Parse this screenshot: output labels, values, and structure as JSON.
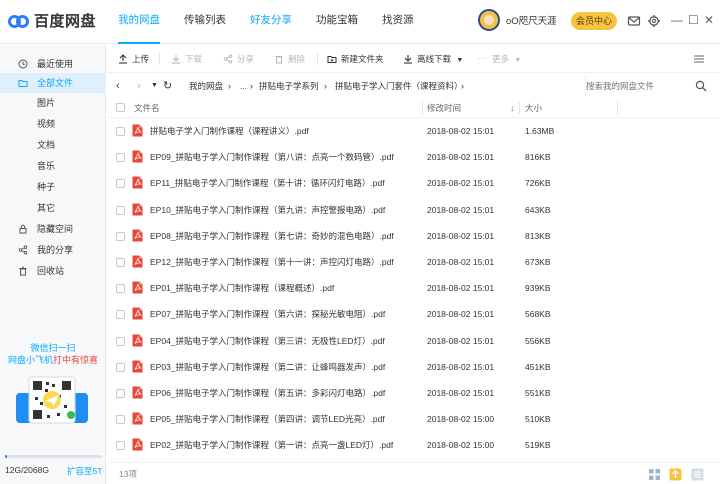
{
  "app": {
    "logo_text": "百度网盘"
  },
  "nav": {
    "tabs": [
      {
        "label": "我的网盘"
      },
      {
        "label": "传输列表"
      },
      {
        "label": "好友分享"
      },
      {
        "label": "功能宝箱"
      },
      {
        "label": "找资源"
      }
    ]
  },
  "user": {
    "name": "oO咫尺天涯",
    "vip_label": "会员中心"
  },
  "sidebar": {
    "items": [
      {
        "label": "最近使用",
        "icon": "clock-icon"
      },
      {
        "label": "全部文件",
        "icon": "folder-icon"
      },
      {
        "label": "图片"
      },
      {
        "label": "视频"
      },
      {
        "label": "文档"
      },
      {
        "label": "音乐"
      },
      {
        "label": "种子"
      },
      {
        "label": "其它"
      },
      {
        "label": "隐藏空间",
        "icon": "lock-icon"
      },
      {
        "label": "我的分享",
        "icon": "share-icon"
      },
      {
        "label": "回收站",
        "icon": "trash-icon"
      }
    ],
    "promo_line1": "微信扫一扫",
    "promo_line2a": "网盘小飞机",
    "promo_line2b": "打中有惊喜",
    "storage_text": "12G/2068G",
    "storage_fraction": 0.006,
    "expand_label": "扩容至5T"
  },
  "toolbar": {
    "upload": "上传",
    "download": "下载",
    "share": "分享",
    "delete": "删除",
    "new_folder": "新建文件夹",
    "offline_download": "离线下载",
    "more": "更多"
  },
  "breadcrumb": {
    "items": [
      "我的网盘",
      "...",
      "拼贴电子学系列",
      "拼贴电子学入门套件（课程资料）"
    ],
    "search_placeholder": "搜索我的网盘文件"
  },
  "list": {
    "headers": {
      "name": "文件名",
      "modified": "修改时间",
      "size": "大小"
    },
    "files": [
      {
        "name": "拼贴电子学入门制作课程（课程讲义）.pdf",
        "modified": "2018-08-02 15:01",
        "size": "1.63MB"
      },
      {
        "name": "EP09_拼贴电子学入门制作课程（第八讲：点亮一个数码管）.pdf",
        "modified": "2018-08-02 15:01",
        "size": "816KB"
      },
      {
        "name": "EP11_拼贴电子学入门制作课程（第十讲：循环闪灯电路）.pdf",
        "modified": "2018-08-02 15:01",
        "size": "726KB"
      },
      {
        "name": "EP10_拼贴电子学入门制作课程（第九讲：声控警报电路）.pdf",
        "modified": "2018-08-02 15:01",
        "size": "643KB"
      },
      {
        "name": "EP08_拼贴电子学入门制作课程（第七讲：奇妙的混色电路）.pdf",
        "modified": "2018-08-02 15:01",
        "size": "813KB"
      },
      {
        "name": "EP12_拼贴电子学入门制作课程（第十一讲：声控闪灯电路）.pdf",
        "modified": "2018-08-02 15:01",
        "size": "673KB"
      },
      {
        "name": "EP01_拼贴电子学入门制作课程（课程概述）.pdf",
        "modified": "2018-08-02 15:01",
        "size": "939KB"
      },
      {
        "name": "EP07_拼贴电子学入门制作课程（第六讲：探秘光敏电阻）.pdf",
        "modified": "2018-08-02 15:01",
        "size": "568KB"
      },
      {
        "name": "EP04_拼贴电子学入门制作课程（第三讲：无极性LED灯）.pdf",
        "modified": "2018-08-02 15:01",
        "size": "556KB"
      },
      {
        "name": "EP03_拼贴电子学入门制作课程（第二讲：让蜂鸣器发声）.pdf",
        "modified": "2018-08-02 15:01",
        "size": "451KB"
      },
      {
        "name": "EP06_拼贴电子学入门制作课程（第五讲：多彩闪灯电路）.pdf",
        "modified": "2018-08-02 15:01",
        "size": "551KB"
      },
      {
        "name": "EP05_拼贴电子学入门制作课程（第四讲：调节LED光亮）.pdf",
        "modified": "2018-08-02 15:00",
        "size": "510KB"
      },
      {
        "name": "EP02_拼贴电子学入门制作课程（第一讲：点亮一盏LED灯）.pdf",
        "modified": "2018-08-02 15:00",
        "size": "519KB"
      }
    ]
  },
  "status": {
    "count": "13项"
  },
  "colors": {
    "accent": "#09aaff",
    "brand_blue": "#2c7ef8",
    "pdf_red": "#e8483b",
    "vip_gold": "#f7c342"
  }
}
